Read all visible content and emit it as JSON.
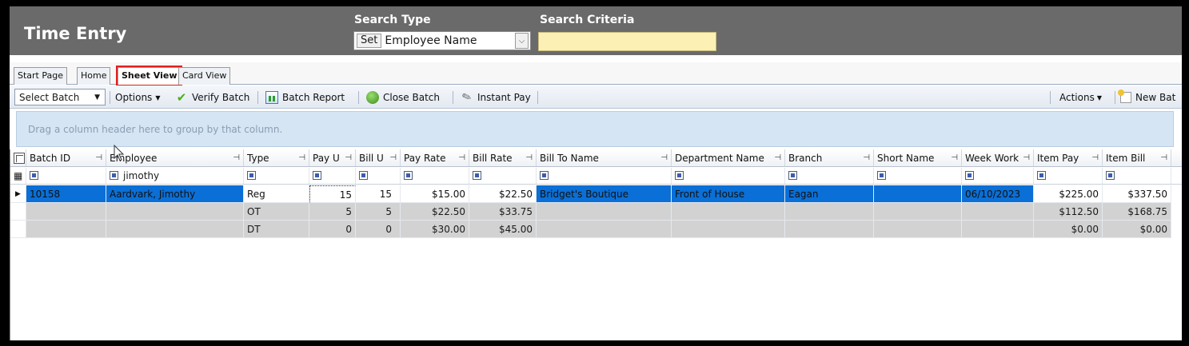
{
  "app": {
    "title": "Time Entry"
  },
  "search": {
    "type_label": "Search Type",
    "criteria_label": "Search Criteria",
    "set_button": "Set",
    "type_value": "Employee Name",
    "criteria_value": ""
  },
  "tabs": [
    {
      "label": "Start Page",
      "active": false
    },
    {
      "label": "Home",
      "active": false
    },
    {
      "label": "Sheet View",
      "active": true
    },
    {
      "label": "Card View",
      "active": false
    }
  ],
  "toolbar": {
    "select_batch": "Select Batch",
    "options": "Options",
    "verify_batch": "Verify Batch",
    "batch_report": "Batch Report",
    "close_batch": "Close Batch",
    "instant_pay": "Instant Pay",
    "actions": "Actions",
    "new_batch": "New Bat"
  },
  "groupby": {
    "hint": "Drag a column header here to group by that column."
  },
  "grid": {
    "columns": [
      "Batch ID",
      "Employee",
      "Type",
      "Pay U",
      "Bill U",
      "Pay Rate",
      "Bill Rate",
      "Bill To Name",
      "Department Name",
      "Branch",
      "Short Name",
      "Week Work",
      "Item Pay",
      "Item Bill"
    ],
    "filter": {
      "employee": "jimothy"
    },
    "rows": [
      {
        "batch_id": "10158",
        "employee": "Aardvark, Jimothy",
        "type": "Reg",
        "pay_u": "15",
        "bill_u": "15",
        "pay_rate": "$15.00",
        "bill_rate": "$22.50",
        "bill_to": "Bridget's Boutique",
        "department": "Front of House",
        "branch": "Eagan",
        "short_name": "",
        "week_work": "06/10/2023",
        "item_pay": "$225.00",
        "item_bill": "$337.50"
      },
      {
        "batch_id": "",
        "employee": "",
        "type": "OT",
        "pay_u": "5",
        "bill_u": "5",
        "pay_rate": "$22.50",
        "bill_rate": "$33.75",
        "bill_to": "",
        "department": "",
        "branch": "",
        "short_name": "",
        "week_work": "",
        "item_pay": "$112.50",
        "item_bill": "$168.75"
      },
      {
        "batch_id": "",
        "employee": "",
        "type": "DT",
        "pay_u": "0",
        "bill_u": "0",
        "pay_rate": "$30.00",
        "bill_rate": "$45.00",
        "bill_to": "",
        "department": "",
        "branch": "",
        "short_name": "",
        "week_work": "",
        "item_pay": "$0.00",
        "item_bill": "$0.00"
      }
    ]
  },
  "colors": {
    "header_bg": "#6a6a6a",
    "selection": "#0a6fd6",
    "criteria_bg": "#fcf0b4",
    "active_tab_outline": "#e02020"
  }
}
